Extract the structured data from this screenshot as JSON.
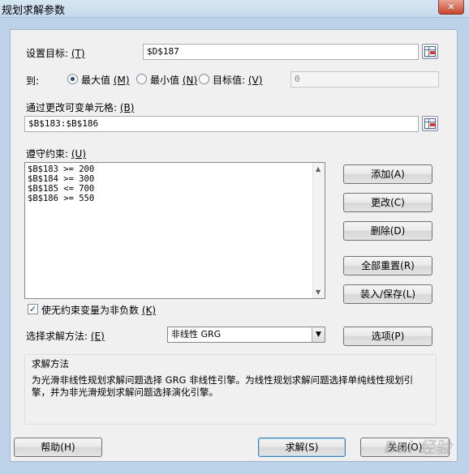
{
  "window": {
    "title": "规划求解参数",
    "close_glyph": "✕"
  },
  "objective": {
    "label": "设置目标:",
    "hotkey": "(T)",
    "value": "$D$187"
  },
  "to": {
    "label": "到:",
    "max": {
      "label": "最大值",
      "hotkey": "(M)",
      "selected": true
    },
    "min": {
      "label": "最小值",
      "hotkey": "(N)",
      "selected": false
    },
    "valueof": {
      "label": "目标值:",
      "hotkey": "(V)",
      "selected": false
    },
    "value": "0"
  },
  "variables": {
    "label": "通过更改可变单元格:",
    "hotkey": "(B)",
    "value": "$B$183:$B$186"
  },
  "constraints": {
    "label": "遵守约束:",
    "hotkey": "(U)",
    "items": [
      "$B$183 >= 200",
      "$B$184 >= 300",
      "$B$185 <= 700",
      "$B$186 >= 550"
    ]
  },
  "buttons": {
    "add": "添加(A)",
    "change": "更改(C)",
    "delete": "删除(D)",
    "reset_all": "全部重置(R)",
    "load_save": "装入/保存(L)",
    "options": "选项(P)",
    "help": "帮助(H)",
    "solve": "求解(S)",
    "close": "关闭(O)"
  },
  "nonneg": {
    "label": "使无约束变量为非负数",
    "hotkey": "(K)",
    "checked": true,
    "check_glyph": "✓"
  },
  "method": {
    "label": "选择求解方法:",
    "hotkey": "(E)",
    "value": "非线性 GRG"
  },
  "method_help": {
    "title": "求解方法",
    "line1": "为光滑非线性规划求解问题选择 GRG 非线性引擎。为线性规划求解问题选择单纯线性规划引",
    "line2": "擎，并为非光滑规划求解问题选择演化引擎。"
  },
  "watermark": "Bai 经验",
  "colors": {
    "accent_selected": "#2a4a7a",
    "frame": "#bcd2e8"
  }
}
